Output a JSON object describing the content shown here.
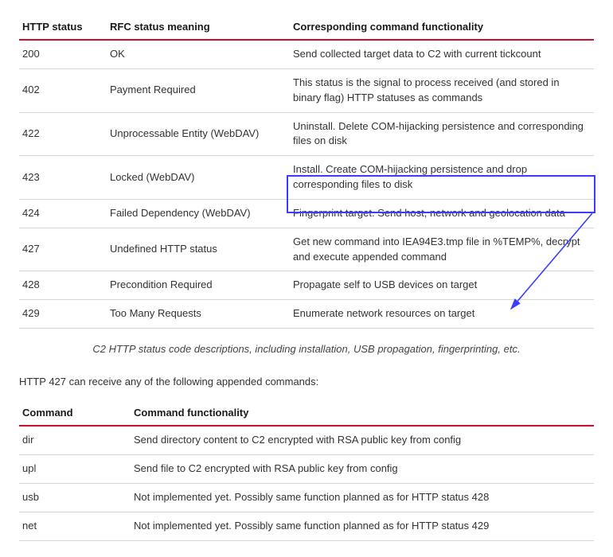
{
  "table1": {
    "headers": [
      "HTTP status",
      "RFC status meaning",
      "Corresponding command functionality"
    ],
    "rows": [
      [
        "200",
        "OK",
        "Send collected target data to C2 with current tickcount"
      ],
      [
        "402",
        "Payment Required",
        "This status is the signal to process received (and stored in binary flag) HTTP statuses as commands"
      ],
      [
        "422",
        "Unprocessable Entity (WebDAV)",
        "Uninstall. Delete COM-hijacking persistence and corresponding files on disk"
      ],
      [
        "423",
        "Locked (WebDAV)",
        "Install. Create COM-hijacking persistence and drop corresponding files to disk"
      ],
      [
        "424",
        "Failed Dependency (WebDAV)",
        "Fingerprint target. Send host, network and geolocation data"
      ],
      [
        "427",
        "Undefined HTTP status",
        "Get new command into IEA94E3.tmp file in %TEMP%, decrypt and execute appended command"
      ],
      [
        "428",
        "Precondition Required",
        "Propagate self to USB devices on target"
      ],
      [
        "429",
        "Too Many Requests",
        "Enumerate network resources on target"
      ]
    ]
  },
  "caption1": "C2 HTTP status code descriptions, including installation, USB propagation, fingerprinting, etc.",
  "paragraph": "HTTP 427 can receive any of the following appended commands:",
  "table2": {
    "headers": [
      "Command",
      "Command functionality"
    ],
    "rows": [
      [
        "dir",
        "Send directory content to C2 encrypted with RSA public key from config"
      ],
      [
        "upl",
        "Send file to C2 encrypted with RSA public key from config"
      ],
      [
        "usb",
        "Not implemented yet. Possibly same function planned as for HTTP status 428"
      ],
      [
        "net",
        "Not implemented yet. Possibly same function planned as for HTTP status 429"
      ]
    ]
  }
}
